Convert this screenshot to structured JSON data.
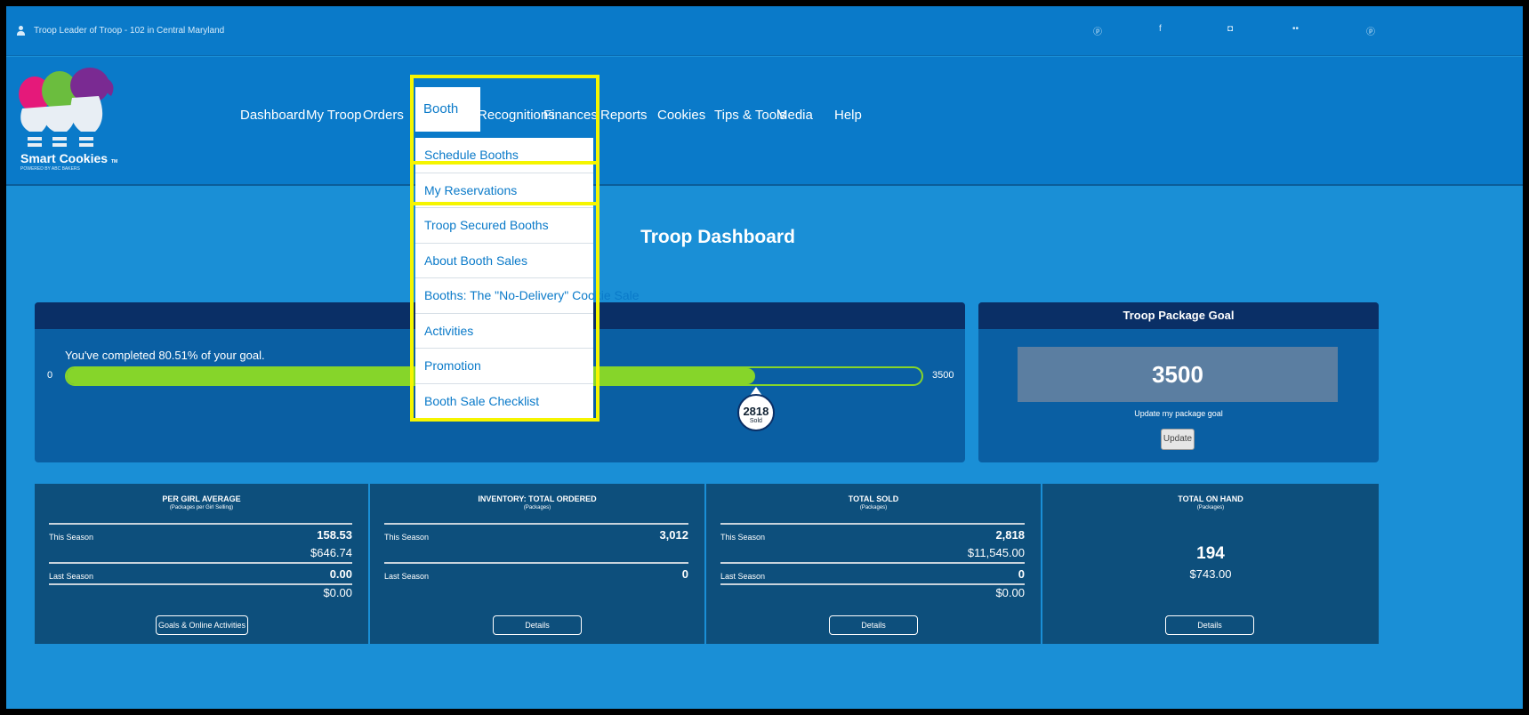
{
  "topbar": {
    "user_text": "Troop Leader of Troop - 102 in Central Maryland",
    "social_icons": [
      "pinterest-icon",
      "facebook-icon",
      "instagram-icon",
      "flickr-icon",
      "pinterest-icon"
    ],
    "social_glyphs": [
      "ⓟ",
      "f",
      "◘",
      "••",
      "ⓟ"
    ]
  },
  "logo": {
    "text": "Smart Cookies",
    "tm": "TM",
    "tagline": "POWERED BY ABC BAKERS"
  },
  "nav": {
    "items": [
      "Dashboard",
      "My Troop",
      "Orders",
      "Booth",
      "Recognitions",
      "Finances",
      "Reports",
      "Cookies",
      "Tips & Tools",
      "Media",
      "Help"
    ]
  },
  "booth_menu": {
    "items": [
      "Schedule Booths",
      "My Reservations",
      "Troop Secured Booths",
      "About Booth Sales",
      "Booths: The \"No-Delivery\" Cookie Sale",
      "Activities",
      "Promotion",
      "Booth Sale Checklist"
    ]
  },
  "main": {
    "title": "Troop Dashboard"
  },
  "progress": {
    "message": "You've completed 80.51% of your goal.",
    "min": "0",
    "max": "3500",
    "sold_value": "2818",
    "sold_label": "Sold",
    "fraction": 0.8051
  },
  "goal": {
    "header": "Troop Package Goal",
    "value": "3500",
    "update_label": "Update my package goal",
    "update_button": "Update"
  },
  "stats": [
    {
      "title": "PER GIRL AVERAGE",
      "subtitle": "(Packages per Girl Selling)",
      "this_label": "This Season",
      "this_value": "158.53",
      "this_money": "$646.74",
      "last_label": "Last Season",
      "last_value": "0.00",
      "last_money": "$0.00",
      "button": "Goals & Online Activities"
    },
    {
      "title": "INVENTORY: TOTAL ORDERED",
      "subtitle": "(Packages)",
      "this_label": "This Season",
      "this_value": "3,012",
      "last_label": "Last Season",
      "last_value": "0",
      "button": "Details"
    },
    {
      "title": "TOTAL SOLD",
      "subtitle": "(Packages)",
      "this_label": "This Season",
      "this_value": "2,818",
      "this_money": "$11,545.00",
      "last_label": "Last Season",
      "last_value": "0",
      "last_money": "$0.00",
      "button": "Details"
    },
    {
      "title": "TOTAL ON HAND",
      "subtitle": "(Packages)",
      "value": "194",
      "money": "$743.00",
      "button": "Details"
    }
  ],
  "colors": {
    "header": "#0a7ac9",
    "background": "#1a8fd6",
    "progress": "#86d52a",
    "highlight": "#f5f500",
    "panel_head": "#0a2f66"
  }
}
